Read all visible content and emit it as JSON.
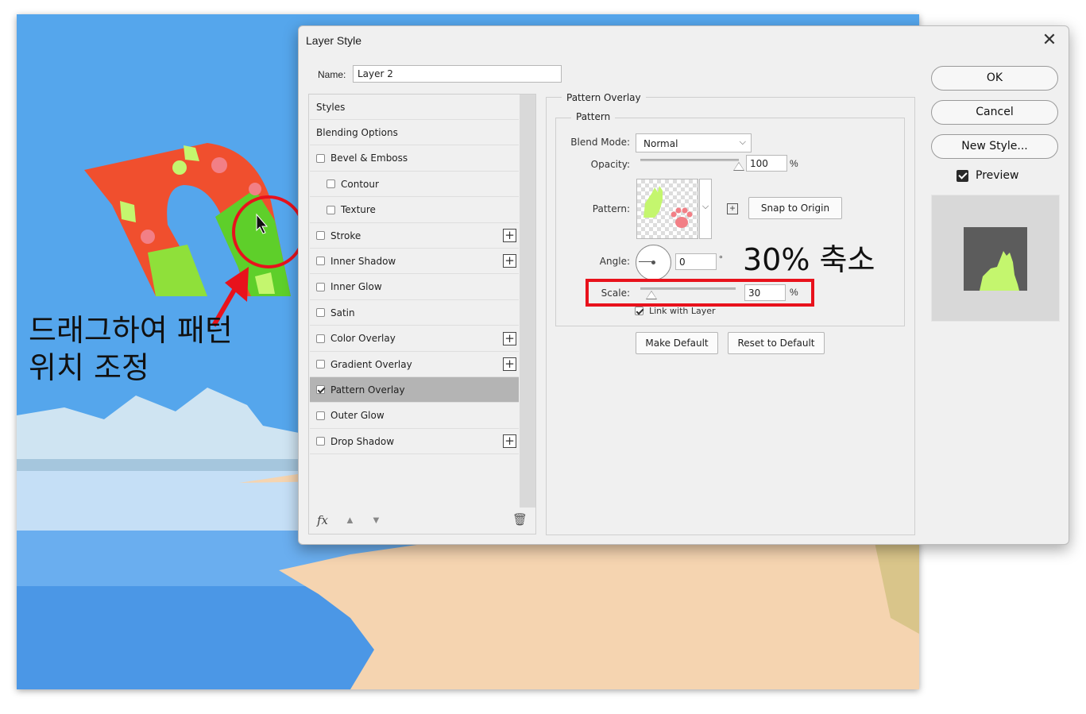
{
  "dialog": {
    "title": "Layer Style",
    "name_label": "Name:",
    "name_value": "Layer 2"
  },
  "styles_list": {
    "items": [
      {
        "label": "Styles",
        "checkbox": false,
        "checked": false,
        "indent": false,
        "plus": false,
        "selected": false
      },
      {
        "label": "Blending Options",
        "checkbox": false,
        "checked": false,
        "indent": false,
        "plus": false,
        "selected": false
      },
      {
        "label": "Bevel & Emboss",
        "checkbox": true,
        "checked": false,
        "indent": false,
        "plus": false,
        "selected": false
      },
      {
        "label": "Contour",
        "checkbox": true,
        "checked": false,
        "indent": true,
        "plus": false,
        "selected": false
      },
      {
        "label": "Texture",
        "checkbox": true,
        "checked": false,
        "indent": true,
        "plus": false,
        "selected": false
      },
      {
        "label": "Stroke",
        "checkbox": true,
        "checked": false,
        "indent": false,
        "plus": true,
        "selected": false
      },
      {
        "label": "Inner Shadow",
        "checkbox": true,
        "checked": false,
        "indent": false,
        "plus": true,
        "selected": false
      },
      {
        "label": "Inner Glow",
        "checkbox": true,
        "checked": false,
        "indent": false,
        "plus": false,
        "selected": false
      },
      {
        "label": "Satin",
        "checkbox": true,
        "checked": false,
        "indent": false,
        "plus": false,
        "selected": false
      },
      {
        "label": "Color Overlay",
        "checkbox": true,
        "checked": false,
        "indent": false,
        "plus": true,
        "selected": false
      },
      {
        "label": "Gradient Overlay",
        "checkbox": true,
        "checked": false,
        "indent": false,
        "plus": true,
        "selected": false
      },
      {
        "label": "Pattern Overlay",
        "checkbox": true,
        "checked": true,
        "indent": false,
        "plus": false,
        "selected": true
      },
      {
        "label": "Outer Glow",
        "checkbox": true,
        "checked": false,
        "indent": false,
        "plus": false,
        "selected": false
      },
      {
        "label": "Drop Shadow",
        "checkbox": true,
        "checked": false,
        "indent": false,
        "plus": true,
        "selected": false
      }
    ],
    "footer": {
      "fx": "fx",
      "up_icon": "arrow-up-icon",
      "down_icon": "arrow-down-icon",
      "trash_icon": "trash-icon"
    }
  },
  "options": {
    "section_title": "Pattern Overlay",
    "group_title": "Pattern",
    "blend_mode_label": "Blend Mode:",
    "blend_mode_value": "Normal",
    "opacity_label": "Opacity:",
    "opacity_value": "100",
    "opacity_fraction": 1.0,
    "percent": "%",
    "pattern_label": "Pattern:",
    "snap_button": "Snap to Origin",
    "angle_label": "Angle:",
    "angle_value": "0",
    "degree": "°",
    "scale_label": "Scale:",
    "scale_value": "30",
    "scale_fraction": 0.03,
    "link_label": "Link with Layer",
    "make_default": "Make Default",
    "reset_default": "Reset to Default"
  },
  "actions": {
    "ok": "OK",
    "cancel": "Cancel",
    "new_style": "New Style...",
    "preview_label": "Preview"
  },
  "annotations": {
    "left": "드래그하여 패턴\n위치 조정",
    "right": "30% 축소",
    "highlight_color": "#e8121c"
  },
  "colors": {
    "sky": "#55a6ec",
    "sea": "#4b97e6",
    "sand": "#f5d4b0",
    "letter_red": "#f04f2e",
    "letter_green": "#4ec51e",
    "pattern_cat": "#c4f66e",
    "pattern_paw": "#f27f86"
  }
}
